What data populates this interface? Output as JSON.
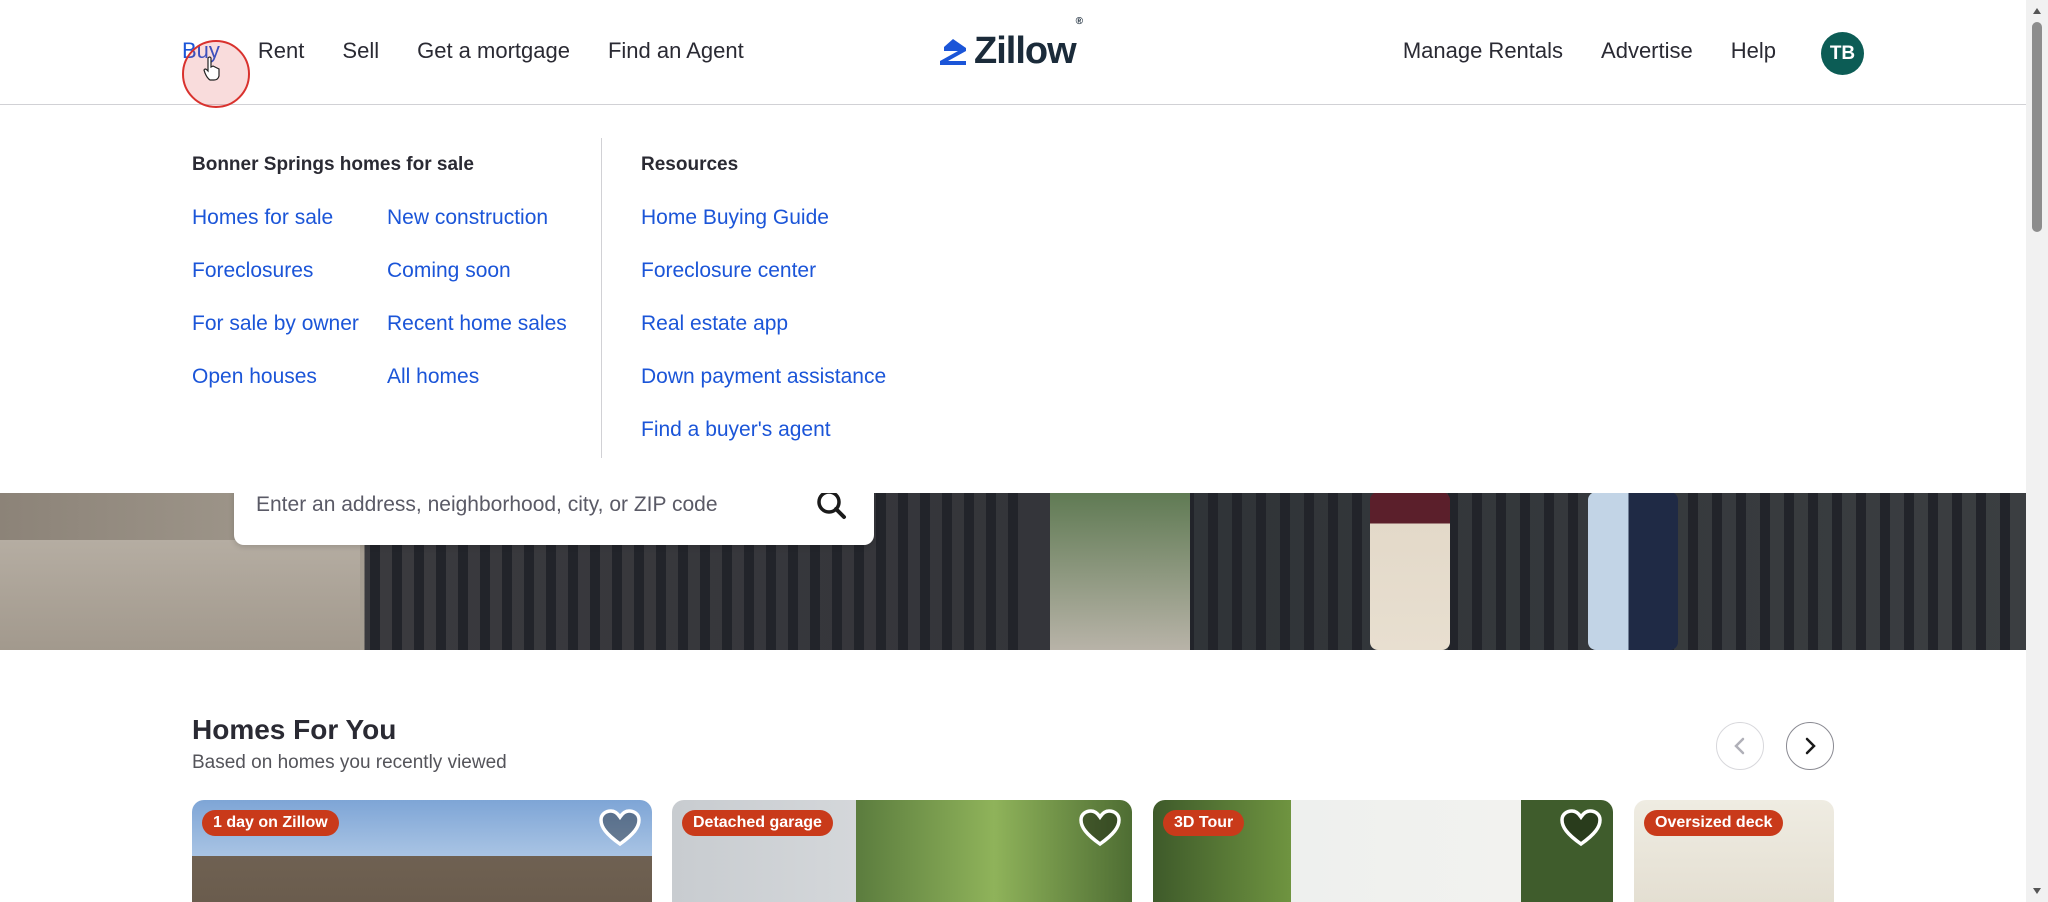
{
  "header": {
    "nav_left": [
      "Buy",
      "Rent",
      "Sell",
      "Get a mortgage",
      "Find an Agent"
    ],
    "logo_text": "Zillow",
    "logo_mark": "®",
    "nav_right": [
      "Manage Rentals",
      "Advertise",
      "Help"
    ],
    "avatar_initials": "TB",
    "brand_color": "#1b55d8",
    "avatar_color": "#0c5c55"
  },
  "mega_menu": {
    "col1_title": "Bonner Springs homes for sale",
    "col1_left": [
      "Homes for sale",
      "Foreclosures",
      "For sale by owner",
      "Open houses"
    ],
    "col1_right": [
      "New construction",
      "Coming soon",
      "Recent home sales",
      "All homes"
    ],
    "col2_title": "Resources",
    "col2_links": [
      "Home Buying Guide",
      "Foreclosure center",
      "Real estate app",
      "Down payment assistance",
      "Find a buyer's agent"
    ]
  },
  "search": {
    "placeholder": "Enter an address, neighborhood, city, or ZIP code",
    "icon": "search-icon"
  },
  "homes_section": {
    "title": "Homes For You",
    "subtitle": "Based on homes you recently viewed",
    "cards": [
      {
        "badge": "1 day on Zillow"
      },
      {
        "badge": "Detached garage"
      },
      {
        "badge": "3D Tour"
      },
      {
        "badge": "Oversized deck"
      }
    ],
    "badge_color": "#c93a1a"
  }
}
